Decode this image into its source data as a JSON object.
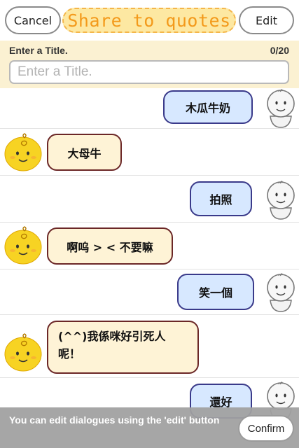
{
  "header": {
    "cancel_label": "Cancel",
    "title": "Share to quotes",
    "edit_label": "Edit"
  },
  "title_field": {
    "label": "Enter a Title.",
    "counter": "0/20",
    "placeholder": "Enter a Title.",
    "value": ""
  },
  "messages": [
    {
      "speaker": "user",
      "text": "木瓜牛奶"
    },
    {
      "speaker": "simsimi",
      "text": "大母牛"
    },
    {
      "speaker": "user",
      "text": "拍照"
    },
    {
      "speaker": "simsimi",
      "text": "啊呜 > < 不要嘛"
    },
    {
      "speaker": "user",
      "text": "笑一個"
    },
    {
      "speaker": "simsimi",
      "text_line1": "(^^)我係咪好引死人",
      "text_line2": "呢！"
    },
    {
      "speaker": "user",
      "text": "還好"
    }
  ],
  "footer": {
    "hint": "You can edit dialogues using the 'edit' button",
    "confirm_label": "Confirm"
  },
  "colors": {
    "title_text": "#f39a1b",
    "title_bg": "#fde8a2",
    "user_bubble": "#d7e8ff",
    "bot_bubble": "#fef3d6",
    "bot_avatar": "#f7d323",
    "footer_bg": "#a0a0a0"
  },
  "icons": {
    "user_avatar": "white-figure-avatar-icon",
    "bot_avatar": "yellow-chick-avatar-icon"
  }
}
